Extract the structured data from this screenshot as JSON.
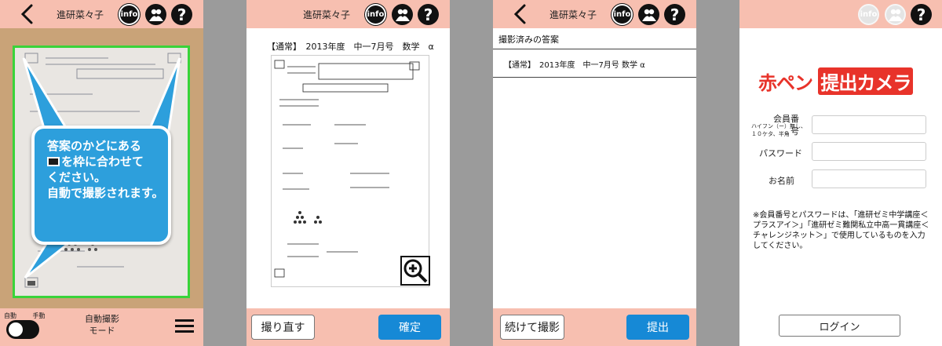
{
  "screen1": {
    "header_title": "進研菜々子",
    "info_label": "info",
    "help_label": "?",
    "guide_lines": [
      "答案のかどにある",
      "を枠に合わせて",
      "ください。",
      "自動で撮影されます。"
    ],
    "toggle_auto_label": "自動",
    "toggle_manual_label": "手動",
    "mode_label_line1": "自動撮影",
    "mode_label_line2": "モード"
  },
  "screen2": {
    "header_title": "進研菜々子",
    "info_label": "info",
    "help_label": "?",
    "document_title": "【通常】　2013年度　中一7月号　数学　α",
    "retake_button": "撮り直す",
    "confirm_button": "確定"
  },
  "screen3": {
    "header_title": "進研菜々子",
    "info_label": "info",
    "help_label": "?",
    "list_heading": "撮影済みの答案",
    "answers": [
      {
        "label": "【通常】　2013年度　中一7月号 数学 α"
      }
    ],
    "continue_button": "続けて撮影",
    "submit_button": "提出"
  },
  "screen4": {
    "info_label": "info",
    "help_label": "?",
    "logo_part1": "赤ペン",
    "logo_part2": "提出カメラ",
    "member_number_label": "会員番号",
    "member_number_note": "ハイフン（ー）無し、\n１０ケタ、半角",
    "password_label": "パスワード",
    "name_label": "お名前",
    "member_number_value": "",
    "password_value": "",
    "name_value": "",
    "notice": "※会員番号とパスワードは、「進研ゼミ中学講座＜プラスアイ＞」「進研ゼミ難関私立中高一貫講座＜チャレンジネット＞」で使用しているものを入力してください。",
    "login_button": "ログイン"
  },
  "colors": {
    "header_bg": "#f7bfb0",
    "accent_blue": "#1689d6",
    "bubble_blue": "#2d9fdc",
    "frame_green": "#39d43a",
    "logo_red": "#e8332a"
  }
}
